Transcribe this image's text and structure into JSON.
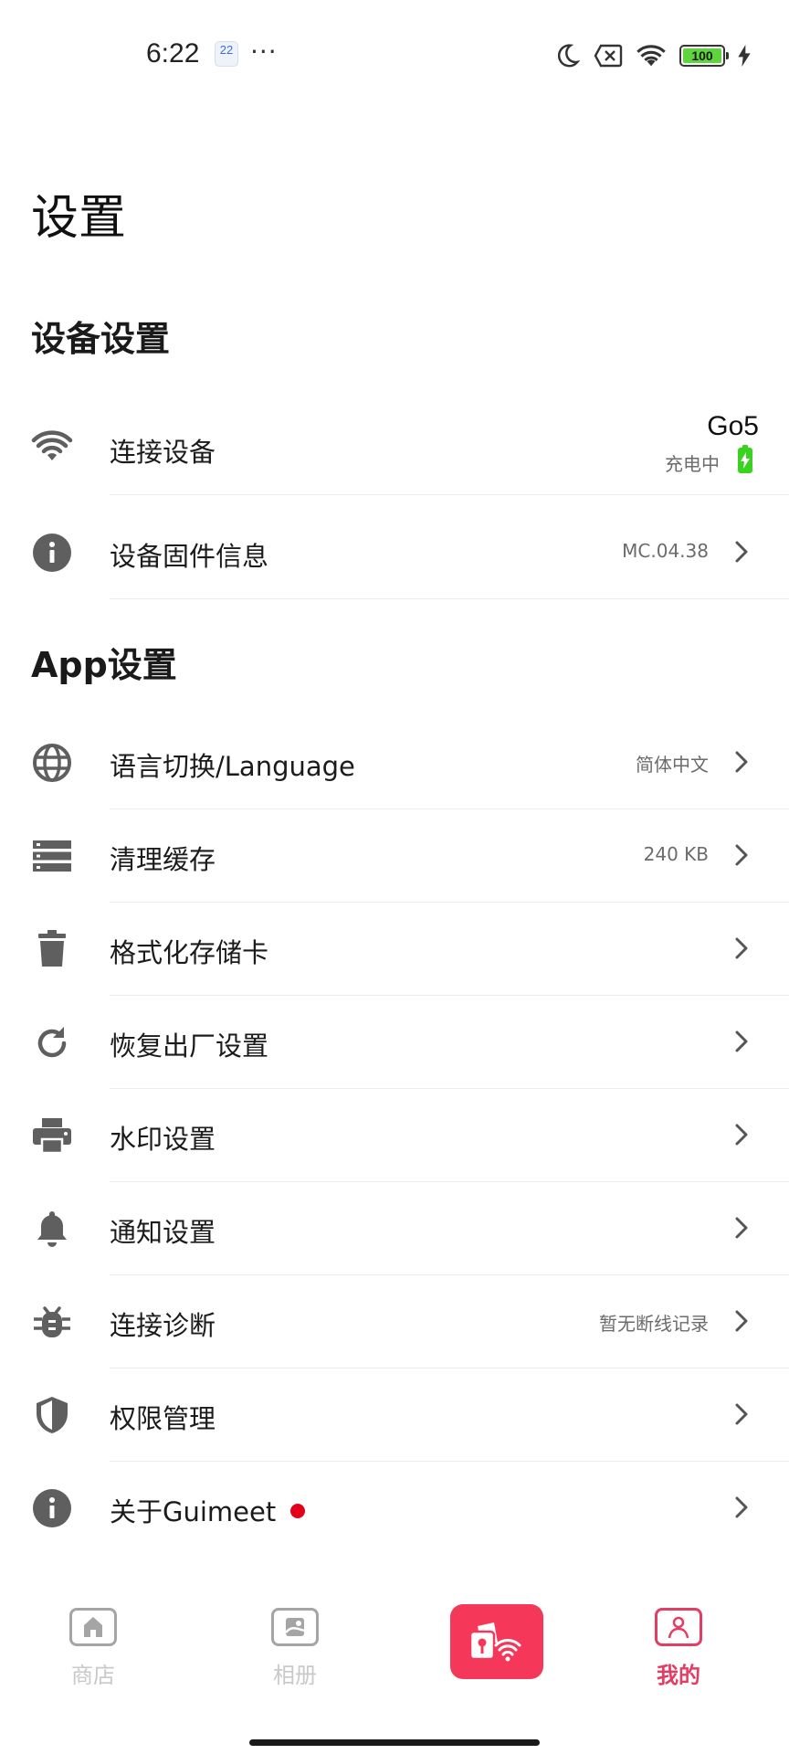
{
  "status_bar": {
    "time": "6:22",
    "calendar_day": "22",
    "more": "···",
    "battery_level": "100",
    "icons": [
      "moon-icon",
      "sim-off-icon",
      "wifi-icon",
      "battery-icon",
      "charging-bolt-icon"
    ]
  },
  "page": {
    "title": "设置"
  },
  "sections": {
    "device": "设备设置",
    "app": "App设置"
  },
  "device_rows": {
    "connect": {
      "label": "连接设备",
      "device_name": "Go5",
      "status": "充电中",
      "icon": "wifi-icon"
    },
    "firmware": {
      "label": "设备固件信息",
      "value": "MC.04.38",
      "icon": "info-icon"
    }
  },
  "app_rows": [
    {
      "label": "语言切换/Language",
      "value": "简体中文",
      "icon": "globe-icon"
    },
    {
      "label": "清理缓存",
      "value": "240 KB",
      "icon": "storage-icon"
    },
    {
      "label": "格式化存储卡",
      "value": "",
      "icon": "trash-icon"
    },
    {
      "label": "恢复出厂设置",
      "value": "",
      "icon": "refresh-icon"
    },
    {
      "label": "水印设置",
      "value": "",
      "icon": "printer-icon"
    },
    {
      "label": "通知设置",
      "value": "",
      "icon": "bell-icon"
    },
    {
      "label": "连接诊断",
      "value": "暂无断线记录",
      "icon": "bug-icon"
    },
    {
      "label": "权限管理",
      "value": "",
      "icon": "shield-icon"
    },
    {
      "label": "关于Guimeet",
      "value": "",
      "icon": "info-icon",
      "badge": "red-dot"
    }
  ],
  "bottom_nav": {
    "store": "商店",
    "album": "相册",
    "camera": "",
    "mine": "我的",
    "active": "mine"
  },
  "colors": {
    "accent": "#e23d62",
    "center_button": "#f5385a",
    "icon_gray": "#5f5f5f",
    "value_gray": "#6b6b6b",
    "badge_red": "#e3001b",
    "charging_green": "#39d21f"
  }
}
